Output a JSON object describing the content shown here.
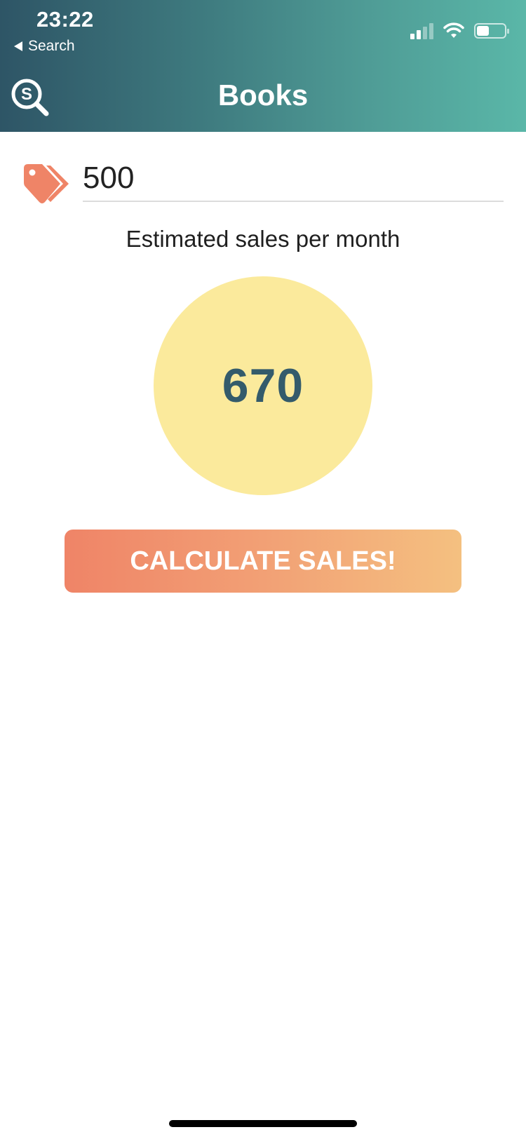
{
  "status_bar": {
    "time": "23:22",
    "back_label": "Search"
  },
  "header": {
    "title": "Books",
    "logo_icon": "search-s-icon",
    "gradient_start": "#2e5566",
    "gradient_end": "#5ab7a8"
  },
  "price_input": {
    "value": "500",
    "icon": "price-tag-icon"
  },
  "estimate": {
    "label": "Estimated sales per month",
    "value": "670",
    "circle_color": "#fbea9c",
    "value_color": "#345b6b"
  },
  "calculate_button": {
    "label": "CALCULATE SALES!",
    "gradient_start": "#ef8467",
    "gradient_end": "#f4c080"
  }
}
